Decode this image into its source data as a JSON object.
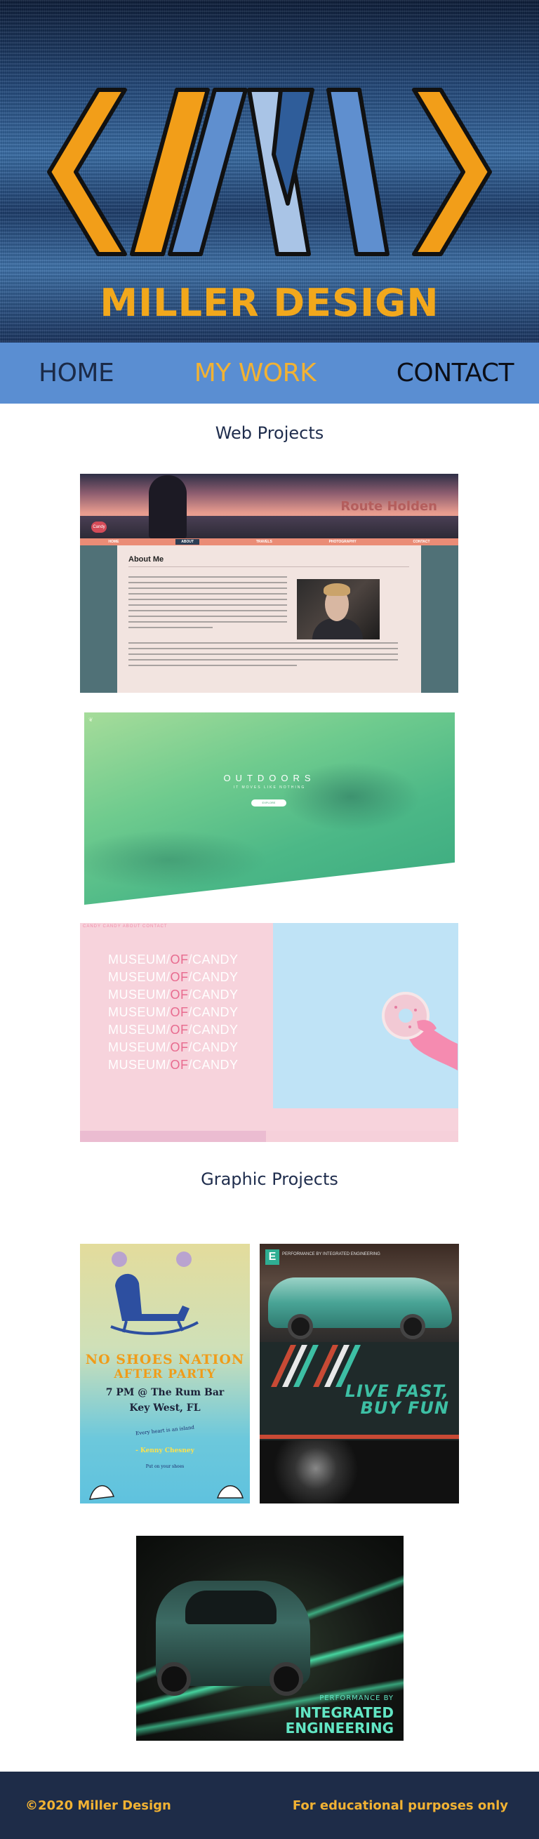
{
  "brand": {
    "name": "MILLER DESIGN"
  },
  "nav": {
    "home": "HOME",
    "my_work": "MY WORK",
    "contact": "CONTACT"
  },
  "sections": {
    "web": "Web Projects",
    "graphic": "Graphic Projects"
  },
  "web_projects": {
    "p1": {
      "site_logo": "Route Holden",
      "badge": "Candy",
      "nav_items": [
        "HOME",
        "ABOUT",
        "TRAVELS",
        "PHOTOGRAPHY",
        "CONTACT"
      ],
      "heading": "About Me"
    },
    "p2": {
      "title": "OUTDOORS",
      "subtitle": "IT MOVES LIKE NOTHING",
      "button": "EXPLORE"
    },
    "p3": {
      "nav": "CANDY  CANDY  ABOUT  CONTACT",
      "line_left": "MUSEUM",
      "line_mid": "OF",
      "line_right": "CANDY"
    }
  },
  "graphic_projects": {
    "poster": {
      "line1": "NO SHOES NATION",
      "line2": "AFTER PARTY",
      "line3": "7 PM @ The Rum Bar",
      "line4": "Key West, FL",
      "quote": "Every heart is an island",
      "author": "- Kenny Chesney",
      "footer": "Put on your shoes"
    },
    "ad": {
      "header": "PERFORMANCE BY INTEGRATED ENGINEERING",
      "slogan1": "LIVE FAST,",
      "slogan2": "BUY FUN"
    },
    "car": {
      "tag1": "PERFORMANCE BY",
      "tag2": "INTEGRATED",
      "tag3": "ENGINEERING"
    }
  },
  "footer": {
    "copyright": "©2020 Miller Design",
    "note": "For educational purposes only"
  },
  "colors": {
    "accent_orange": "#f2a81c",
    "nav_blue": "#5a8ed2",
    "footer_navy": "#1e2c48"
  }
}
